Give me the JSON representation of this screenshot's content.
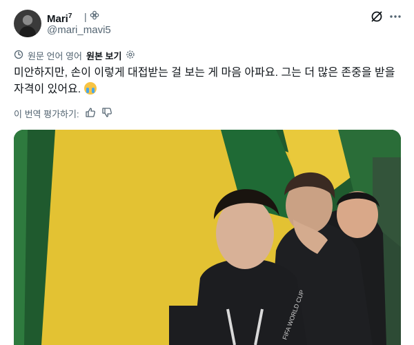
{
  "author": {
    "display_name": "Mari",
    "superscript": "7",
    "name_suffix": "|",
    "handle": "@mari_mavi5"
  },
  "translation": {
    "label": "원문 언어 영어",
    "show_original": "원본 보기"
  },
  "tweet": {
    "text": "미안하지만, 손이 이렇게 대접받는 걸 보는 게 마음 아파요. 그는 더 많은 존중을 받을 자격이 있어요. "
  },
  "rating": {
    "label": "이 번역 평가하기:"
  },
  "icons": {
    "badge": "flower-badge-icon",
    "grok": "grok-icon",
    "more": "more-options-icon",
    "translate": "translate-icon",
    "settings": "gear-icon",
    "thumbs_up": "thumbs-up-icon",
    "thumbs_down": "thumbs-down-icon",
    "emoji": "crying-face-emoji"
  },
  "media": {
    "description_colors": {
      "yellow": "#e3c233",
      "green": "#1f5a2e",
      "jacket": "#1b1c1e"
    },
    "lanyard_text": "FIFA WORLD CUP"
  }
}
